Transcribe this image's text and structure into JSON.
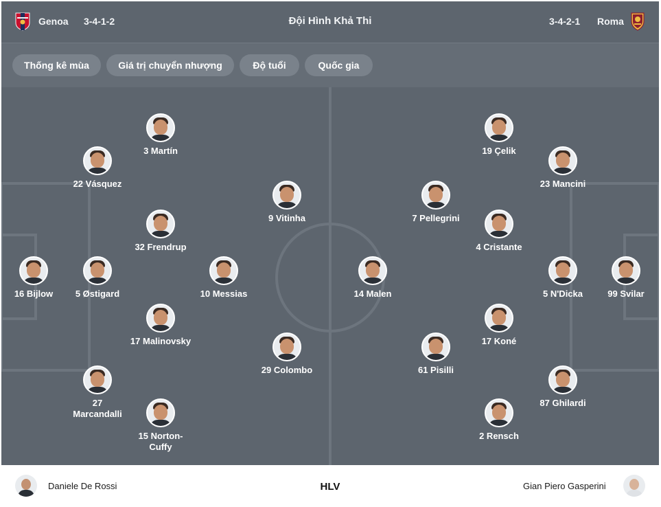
{
  "header": {
    "home_team": "Genoa",
    "home_formation": "3-4-1-2",
    "title": "Đội Hình Khả Thi",
    "away_formation": "3-4-2-1",
    "away_team": "Roma"
  },
  "tabs": [
    {
      "label": "Thống kê mùa"
    },
    {
      "label": "Giá trị chuyển nhượng"
    },
    {
      "label": "Độ tuổi"
    },
    {
      "label": "Quốc gia"
    }
  ],
  "home_players": [
    {
      "label": "16 Bijlow"
    },
    {
      "label": "5 Østigard"
    },
    {
      "label": "3 Martín"
    },
    {
      "label": "22 Vásquez"
    },
    {
      "label": "32 Frendrup"
    },
    {
      "label": "17 Malinovsky"
    },
    {
      "label": "27 Marcandalli"
    },
    {
      "label": "15 Norton-Cuffy"
    },
    {
      "label": "10 Messias"
    },
    {
      "label": "9 Vitinha"
    },
    {
      "label": "29 Colombo"
    }
  ],
  "away_players": [
    {
      "label": "99 Svilar"
    },
    {
      "label": "5 N'Dicka"
    },
    {
      "label": "23 Mancini"
    },
    {
      "label": "87 Ghilardi"
    },
    {
      "label": "19 Çelik"
    },
    {
      "label": "4 Cristante"
    },
    {
      "label": "17 Koné"
    },
    {
      "label": "2 Rensch"
    },
    {
      "label": "7 Pellegrini"
    },
    {
      "label": "61 Pisilli"
    },
    {
      "label": "14 Malen"
    }
  ],
  "footer": {
    "home_coach": "Daniele De Rossi",
    "label": "HLV",
    "away_coach": "Gian Piero Gasperini"
  },
  "colors": {
    "header_bg": "#5d656e",
    "pitch_bg": "#5d656e",
    "tab_bg": "#7a828b",
    "genoa_red": "#c8102e",
    "genoa_blue": "#1d2d5c",
    "roma_red": "#8e1f2f",
    "roma_gold": "#f0bc42"
  },
  "icons": {
    "home_crest": "genoa-crest-icon",
    "away_crest": "roma-crest-icon"
  }
}
